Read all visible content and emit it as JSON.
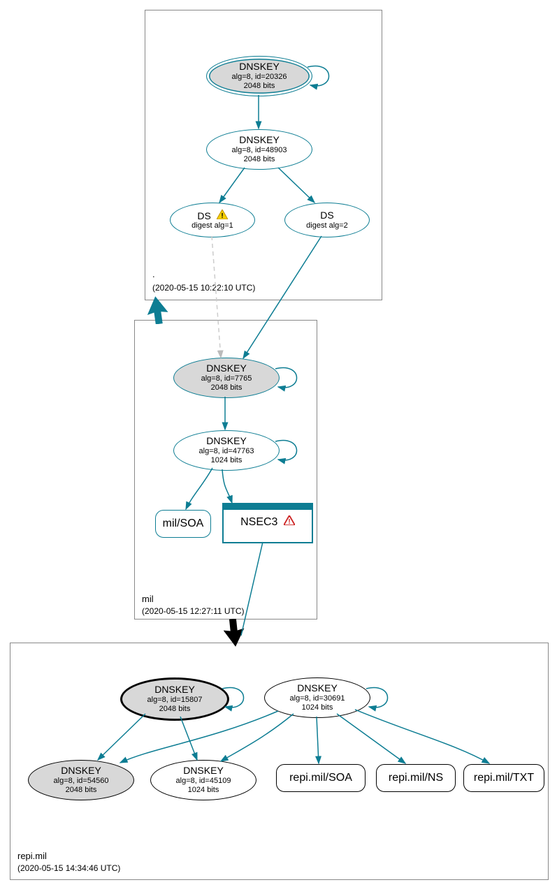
{
  "zones": {
    "root": {
      "name": ".",
      "timestamp": "(2020-05-15 10:22:10 UTC)",
      "dnskey1": {
        "title": "DNSKEY",
        "line1": "alg=8, id=20326",
        "line2": "2048 bits"
      },
      "dnskey2": {
        "title": "DNSKEY",
        "line1": "alg=8, id=48903",
        "line2": "2048 bits"
      },
      "ds1": {
        "title": "DS",
        "line1": "digest alg=1"
      },
      "ds2": {
        "title": "DS",
        "line1": "digest alg=2"
      }
    },
    "mil": {
      "name": "mil",
      "timestamp": "(2020-05-15 12:27:11 UTC)",
      "dnskey1": {
        "title": "DNSKEY",
        "line1": "alg=8, id=7765",
        "line2": "2048 bits"
      },
      "dnskey2": {
        "title": "DNSKEY",
        "line1": "alg=8, id=47763",
        "line2": "1024 bits"
      },
      "soa": "mil/SOA",
      "nsec3": "NSEC3"
    },
    "repi": {
      "name": "repi.mil",
      "timestamp": "(2020-05-15 14:34:46 UTC)",
      "dnskey1": {
        "title": "DNSKEY",
        "line1": "alg=8, id=15807",
        "line2": "2048 bits"
      },
      "dnskey2": {
        "title": "DNSKEY",
        "line1": "alg=8, id=30691",
        "line2": "1024 bits"
      },
      "dnskey3": {
        "title": "DNSKEY",
        "line1": "alg=8, id=54560",
        "line2": "2048 bits"
      },
      "dnskey4": {
        "title": "DNSKEY",
        "line1": "alg=8, id=45109",
        "line2": "1024 bits"
      },
      "soa": "repi.mil/SOA",
      "ns": "repi.mil/NS",
      "txt": "repi.mil/TXT"
    }
  }
}
